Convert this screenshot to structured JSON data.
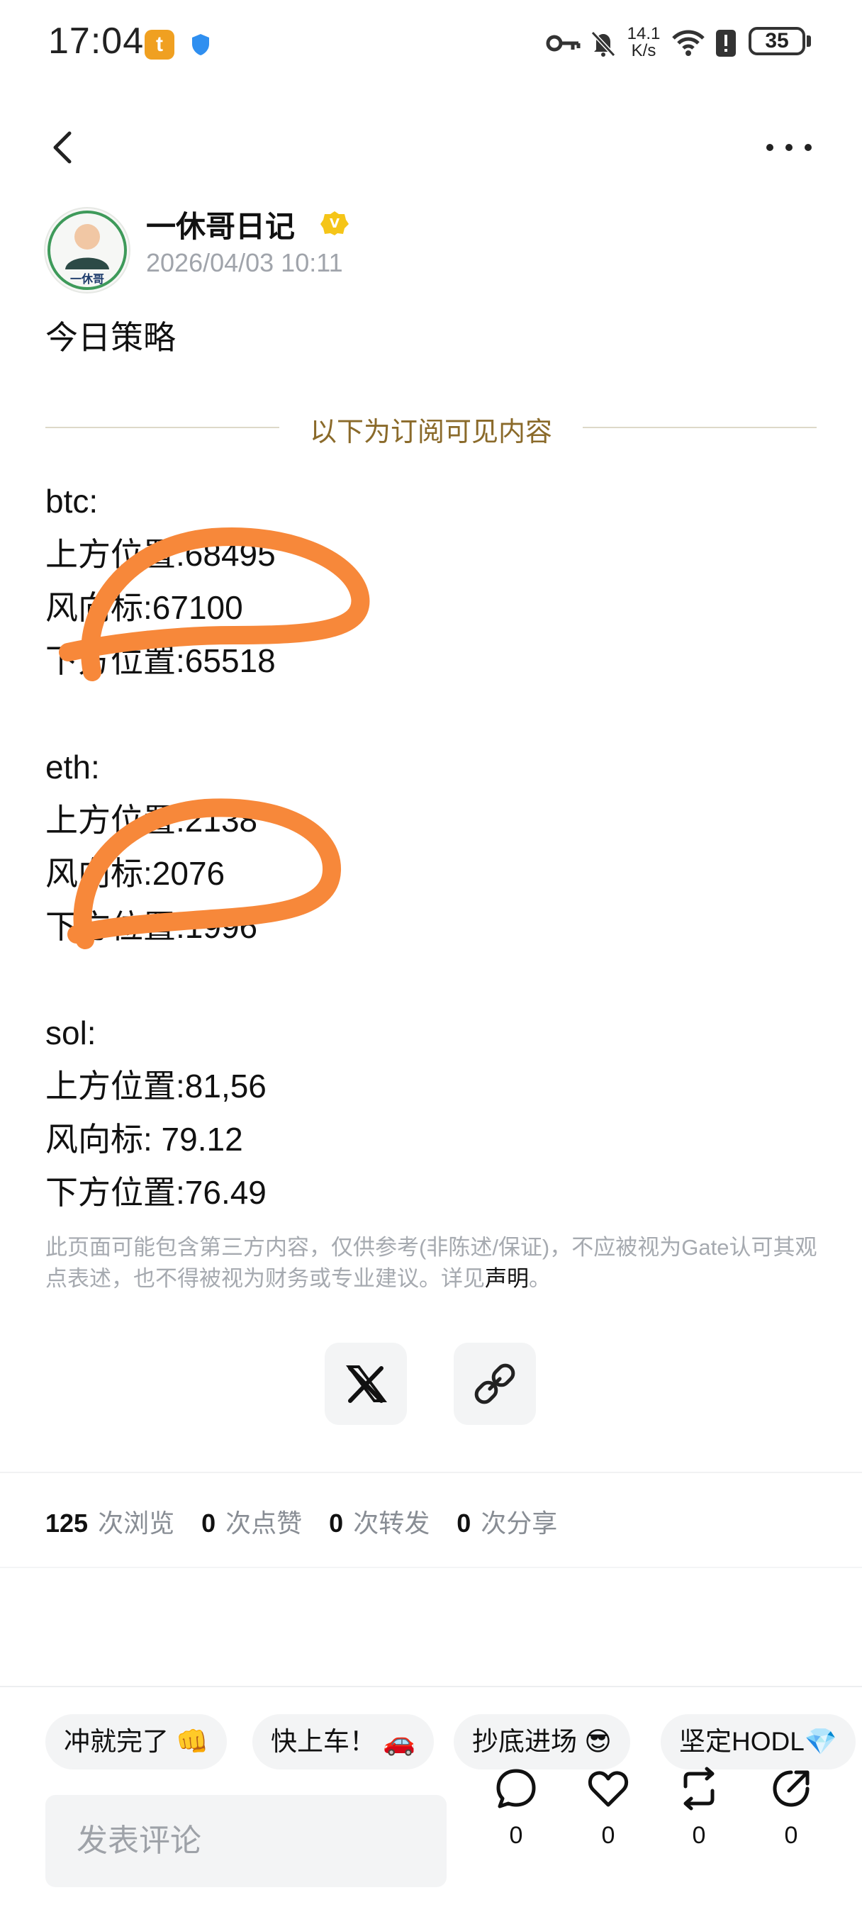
{
  "status_bar": {
    "time": "17:04",
    "app_badge": "t",
    "speed_value": "14.1",
    "speed_unit": "K/s",
    "battery": "35",
    "icons": [
      "app-notification-icon",
      "shield-icon",
      "key-icon",
      "bell-muted-icon",
      "wifi-icon",
      "alert-icon",
      "battery-icon"
    ]
  },
  "nav": {
    "back_icon": "chevron-left-icon",
    "more_icon": "more-icon"
  },
  "author": {
    "name": "一休哥日记",
    "avatar_label": "一休哥",
    "verified_mark": "V",
    "date": "2026/04/03 10:11"
  },
  "post": {
    "title": "今日策略",
    "divider_label": "以下为订阅可见内容",
    "lines": [
      "btc:",
      "上方位置:68495",
      "风向标:67100",
      "下方位置:65518",
      "",
      "eth:",
      "上方位置:2138",
      "风向标:2076",
      "下方位置:1996",
      "",
      "sol:",
      "上方位置:81,56",
      "风向标: 79.12",
      "下方位置:76.49"
    ],
    "disclaimer": "此页面可能包含第三方内容，仅供参考(非陈述/保证)，不应被视为Gate认可其观点表述，也不得被视为财务或专业建议。详见",
    "disclaimer_link": "声明",
    "disclaimer_end": "。"
  },
  "share": {
    "x_icon": "x-logo-icon",
    "link_icon": "link-icon"
  },
  "stats": [
    {
      "value": "125",
      "label": "次浏览"
    },
    {
      "value": "0",
      "label": "次点赞"
    },
    {
      "value": "0",
      "label": "次转发"
    },
    {
      "value": "0",
      "label": "次分享"
    }
  ],
  "quick_replies": [
    {
      "text": "冲就完了",
      "emoji": "👊"
    },
    {
      "text": "快上车！",
      "emoji": "🚗"
    },
    {
      "text": "抄底进场",
      "emoji": "😎"
    },
    {
      "text": "坚定HODL",
      "emoji": "💎"
    }
  ],
  "comment": {
    "placeholder": "发表评论"
  },
  "actions": {
    "comment_count": "0",
    "like_count": "0",
    "repost_count": "0",
    "share_count": "0"
  },
  "colors": {
    "divider_text": "#8a6a2a",
    "annotation": "#f7883a",
    "muted_text": "#a6aab0",
    "chip_bg": "#f3f4f5"
  }
}
